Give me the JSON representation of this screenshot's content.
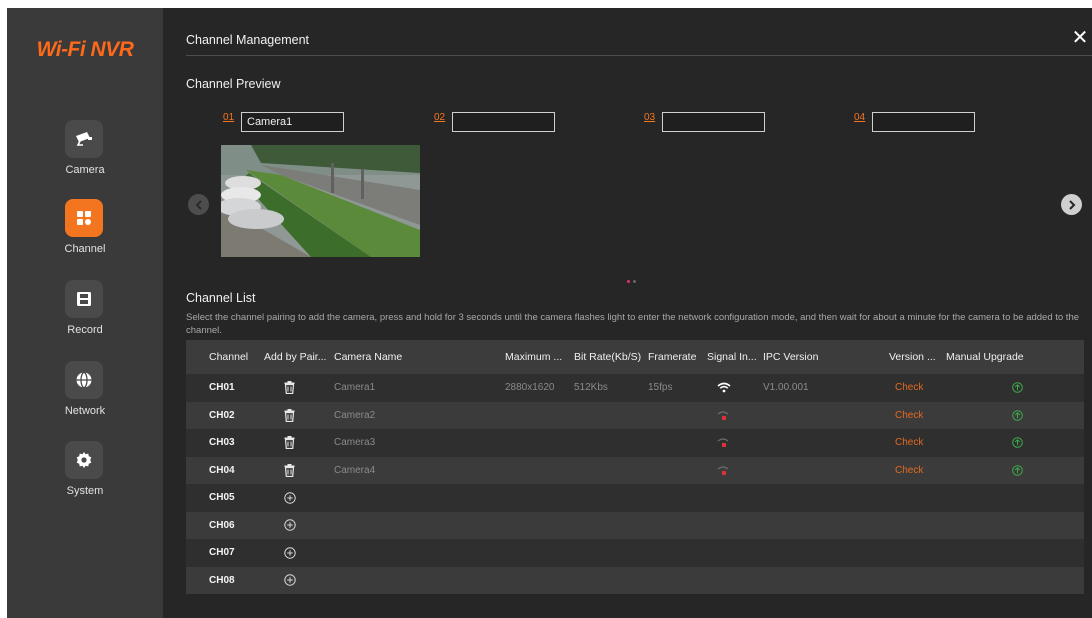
{
  "sidebar": {
    "logo": "Wi-Fi NVR",
    "items": [
      {
        "label": "Camera",
        "icon": "camera-icon",
        "active": false
      },
      {
        "label": "Channel",
        "icon": "channel-grid-icon",
        "active": true
      },
      {
        "label": "Record",
        "icon": "film-icon",
        "active": false
      },
      {
        "label": "Network",
        "icon": "globe-icon",
        "active": false
      },
      {
        "label": "System",
        "icon": "gear-icon",
        "active": false
      }
    ]
  },
  "header": {
    "title": "Channel Management",
    "close": "✕"
  },
  "preview": {
    "title": "Channel Preview",
    "channels": [
      {
        "num": "01",
        "name": "Camera1"
      },
      {
        "num": "02",
        "name": ""
      },
      {
        "num": "03",
        "name": ""
      },
      {
        "num": "04",
        "name": ""
      }
    ],
    "page_dots": 2,
    "active_page": 1
  },
  "list": {
    "title": "Channel List",
    "description": "Select the channel pairing to add the camera, press and hold for 3 seconds until the camera flashes light to enter the network configuration mode, and then wait for about a minute for the camera to be added to the channel.",
    "columns": [
      "Channel",
      "Add by Pair...",
      "Camera Name",
      "Maximum ...",
      "Bit Rate(Kb/S)",
      "Framerate",
      "Signal In...",
      "IPC Version",
      "Version ...",
      "Manual Upgrade"
    ],
    "rows": [
      {
        "channel": "CH01",
        "action": "delete",
        "name": "Camera1",
        "resolution": "2880x1620",
        "bitrate": "512Kbs",
        "framerate": "15fps",
        "signal": "strong",
        "ipc_version": "V1.00.001",
        "version": "Check",
        "upgrade": true
      },
      {
        "channel": "CH02",
        "action": "delete",
        "name": "Camera2",
        "resolution": "",
        "bitrate": "",
        "framerate": "",
        "signal": "none",
        "ipc_version": "",
        "version": "Check",
        "upgrade": true
      },
      {
        "channel": "CH03",
        "action": "delete",
        "name": "Camera3",
        "resolution": "",
        "bitrate": "",
        "framerate": "",
        "signal": "none",
        "ipc_version": "",
        "version": "Check",
        "upgrade": true
      },
      {
        "channel": "CH04",
        "action": "delete",
        "name": "Camera4",
        "resolution": "",
        "bitrate": "",
        "framerate": "",
        "signal": "none",
        "ipc_version": "",
        "version": "Check",
        "upgrade": true
      },
      {
        "channel": "CH05",
        "action": "add",
        "name": "",
        "resolution": "",
        "bitrate": "",
        "framerate": "",
        "signal": "",
        "ipc_version": "",
        "version": "",
        "upgrade": false
      },
      {
        "channel": "CH06",
        "action": "add",
        "name": "",
        "resolution": "",
        "bitrate": "",
        "framerate": "",
        "signal": "",
        "ipc_version": "",
        "version": "",
        "upgrade": false
      },
      {
        "channel": "CH07",
        "action": "add",
        "name": "",
        "resolution": "",
        "bitrate": "",
        "framerate": "",
        "signal": "",
        "ipc_version": "",
        "version": "",
        "upgrade": false
      },
      {
        "channel": "CH08",
        "action": "add",
        "name": "",
        "resolution": "",
        "bitrate": "",
        "framerate": "",
        "signal": "",
        "ipc_version": "",
        "version": "",
        "upgrade": false
      }
    ]
  },
  "colors": {
    "accent": "#f47520",
    "check": "#e06a1e",
    "upgrade": "#3ea84a",
    "signal_ok": "#ffffff",
    "signal_bad": "#e0303a"
  }
}
